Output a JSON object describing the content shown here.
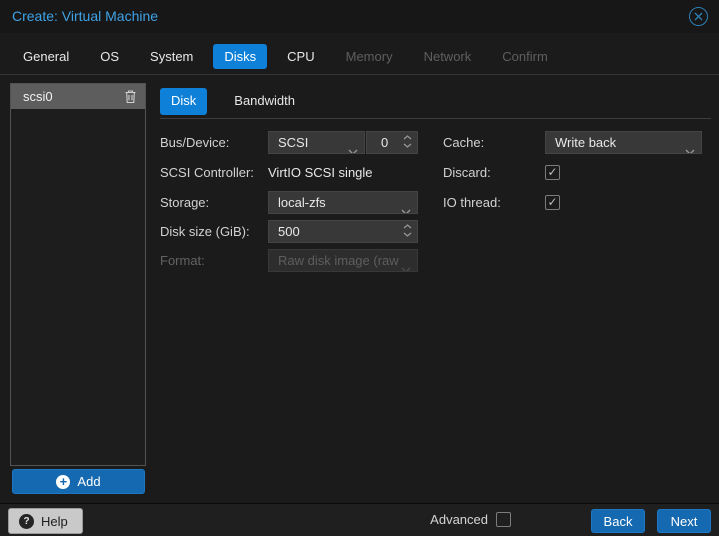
{
  "window": {
    "title": "Create: Virtual Machine"
  },
  "wizard_tabs": [
    {
      "label": "General",
      "state": "enabled"
    },
    {
      "label": "OS",
      "state": "enabled"
    },
    {
      "label": "System",
      "state": "enabled"
    },
    {
      "label": "Disks",
      "state": "active"
    },
    {
      "label": "CPU",
      "state": "enabled"
    },
    {
      "label": "Memory",
      "state": "disabled"
    },
    {
      "label": "Network",
      "state": "disabled"
    },
    {
      "label": "Confirm",
      "state": "disabled"
    }
  ],
  "sidebar": {
    "items": [
      {
        "label": "scsi0",
        "selected": true
      }
    ],
    "add_button": "Add"
  },
  "disk_panel": {
    "tabs": [
      {
        "label": "Disk",
        "active": true
      },
      {
        "label": "Bandwidth",
        "active": false
      }
    ],
    "fields": {
      "bus_device": {
        "label": "Bus/Device:",
        "bus": "SCSI",
        "device": "0"
      },
      "scsi_controller": {
        "label": "SCSI Controller:",
        "value": "VirtIO SCSI single"
      },
      "storage": {
        "label": "Storage:",
        "value": "local-zfs"
      },
      "disk_size": {
        "label": "Disk size (GiB):",
        "value": "500"
      },
      "format": {
        "label": "Format:",
        "value": "Raw disk image (raw",
        "disabled": true
      },
      "cache": {
        "label": "Cache:",
        "value": "Write back"
      },
      "discard": {
        "label": "Discard:",
        "checked": true
      },
      "io_thread": {
        "label": "IO thread:",
        "checked": true
      }
    }
  },
  "footer": {
    "help": "Help",
    "advanced": "Advanced",
    "advanced_checked": false,
    "back": "Back",
    "next": "Next"
  },
  "colors": {
    "active_tab_blue": "#0e80d8",
    "button_blue": "#1569b0",
    "title_blue": "#3fa2e6",
    "dialog_bg": "#1b1b1b",
    "field_bg": "#383838"
  }
}
